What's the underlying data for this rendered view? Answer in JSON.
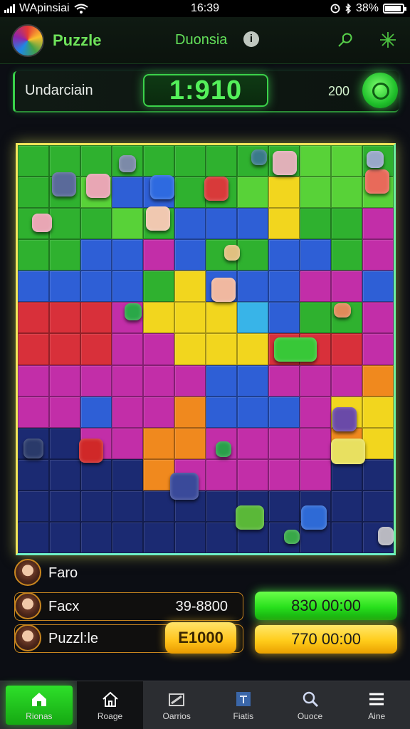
{
  "status_bar": {
    "carrier": "WApinsiai",
    "time": "16:39",
    "battery": "38%"
  },
  "header": {
    "app_title": "Puzzle",
    "center_title": "Duonsia",
    "info_glyph": "i",
    "icons": [
      "pin-icon",
      "sparkle-icon"
    ]
  },
  "info_panel": {
    "label": "Undarciain",
    "timer": "1:910",
    "score": "200"
  },
  "board": {
    "columns": 12,
    "rows": 13,
    "palette": {
      "green": "#2fb12f",
      "lime": "#58d238",
      "blue": "#2e5fd6",
      "yellow": "#f2d61e",
      "orange": "#f0891e",
      "red": "#d8303a",
      "magenta": "#c22ea8",
      "purple": "#7a2cc0",
      "navy": "#1b2a72",
      "cyan": "#38b4e8"
    }
  },
  "players": [
    {
      "name": "Faro"
    },
    {
      "name": "Facx",
      "score": "39-8800"
    },
    {
      "name": "Puzzl:le",
      "badge": "E1000"
    }
  ],
  "side_buttons": {
    "green_label": "830 00:00",
    "yellow_label": "770 00:00"
  },
  "nav": {
    "items": [
      {
        "label": "Rionas",
        "icon": "home-icon"
      },
      {
        "label": "Roage",
        "icon": "house-outline-icon"
      },
      {
        "label": "Oarrios",
        "icon": "pencil-icon"
      },
      {
        "label": "Fiatis",
        "icon": "box-icon"
      },
      {
        "label": "Ouoce",
        "icon": "search-icon"
      },
      {
        "label": "Aine",
        "icon": "menu-icon"
      }
    ]
  }
}
